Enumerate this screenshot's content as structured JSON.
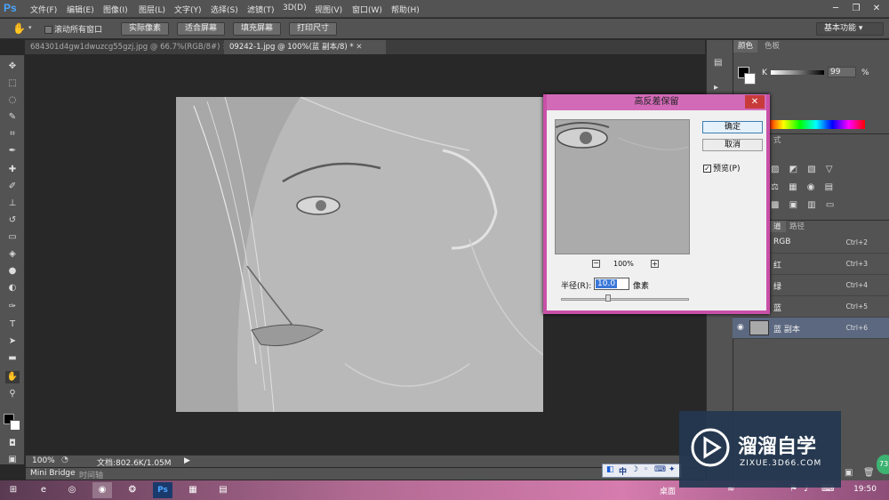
{
  "app": {
    "logo": "Ps"
  },
  "menu": [
    "文件(F)",
    "编辑(E)",
    "图像(I)",
    "图层(L)",
    "文字(Y)",
    "选择(S)",
    "滤镜(T)",
    "3D(D)",
    "视图(V)",
    "窗口(W)",
    "帮助(H)"
  ],
  "options": {
    "scroll_all": "滚动所有窗口",
    "buttons": [
      "实际像素",
      "适合屏幕",
      "填充屏幕",
      "打印尺寸"
    ],
    "workspace": "基本功能"
  },
  "tabs": [
    {
      "label": "684301d4gw1dwuzcg55gzj.jpg @ 66.7%(RGB/8#)"
    },
    {
      "label": "09242-1.jpg @ 100%(蓝 副本/8) *"
    }
  ],
  "status": {
    "zoom": "100%",
    "doc": "文档:802.6K/1.05M"
  },
  "bottom_tabs": [
    "Mini Bridge",
    "时间轴"
  ],
  "panels": {
    "color_tabs": [
      "颜色",
      "色板"
    ],
    "k_label": "K",
    "k_value": "99",
    "k_unit": "%",
    "styles_tab_fragment": "式",
    "channel_tabs": [
      "道",
      "路径"
    ],
    "channels": [
      {
        "name": "RGB",
        "key": "Ctrl+2"
      },
      {
        "name": "红",
        "key": "Ctrl+3"
      },
      {
        "name": "绿",
        "key": "Ctrl+4"
      },
      {
        "name": "蓝",
        "key": "Ctrl+5"
      },
      {
        "name": "蓝 副本",
        "key": "Ctrl+6",
        "selected": true
      }
    ]
  },
  "dialog": {
    "title": "高反差保留",
    "ok": "确定",
    "cancel": "取消",
    "preview_label": "预览(P)",
    "preview_checked": true,
    "zoom": "100%",
    "radius_label": "半径(R):",
    "radius_value": "10.0",
    "radius_unit": "像素",
    "radius_slider_fraction": 0.37
  },
  "ime": {
    "label": "中"
  },
  "taskbar": {
    "desktop": "桌面",
    "time": "19:50"
  },
  "watermark": {
    "brand": "溜溜自学",
    "url": "ZIXUE.3D66.COM"
  },
  "badge": "73",
  "colors": {
    "dialog_border": "#c950a8",
    "accent": "#3b78d8"
  }
}
